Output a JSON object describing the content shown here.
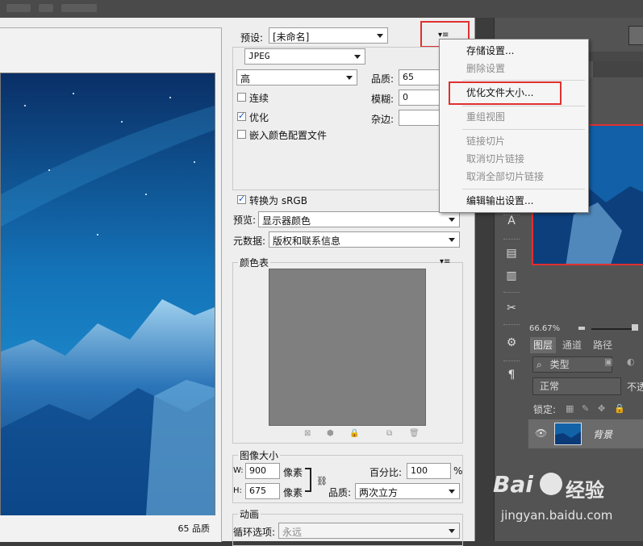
{
  "settings": {
    "preset_label": "预设:",
    "preset_value": "[未命名]",
    "format_value": "JPEG",
    "quality_level": "高",
    "quality_label": "品质:",
    "quality_value": "65",
    "progressive_label": "连续",
    "blur_label": "模糊:",
    "blur_value": "0",
    "optimized_label": "优化",
    "matte_label": "杂边:",
    "embed_profile_label": "嵌入颜色配置文件",
    "convert_srgb_label": "转换为 sRGB",
    "preview_label": "预览:",
    "preview_value": "显示器颜色",
    "metadata_label": "元数据:",
    "metadata_value": "版权和联系信息"
  },
  "color_table": {
    "title": "颜色表"
  },
  "image_size": {
    "title": "图像大小",
    "w_label": "W:",
    "w_value": "900",
    "h_label": "H:",
    "h_value": "675",
    "unit": "像素",
    "percent_label": "百分比:",
    "percent_value": "100",
    "percent_unit": "%",
    "quality_label": "品质:",
    "quality_value": "两次立方"
  },
  "animation": {
    "title": "动画",
    "loop_label": "循环选项:",
    "loop_value": "永远"
  },
  "preview_status": "65 品质",
  "menu": {
    "items": [
      {
        "label": "存储设置...",
        "enabled": true
      },
      {
        "label": "删除设置",
        "enabled": false
      },
      {
        "label": "优化文件大小...",
        "enabled": true
      },
      {
        "label": "重组视图",
        "enabled": false
      },
      {
        "label": "链接切片",
        "enabled": false
      },
      {
        "label": "取消切片链接",
        "enabled": false
      },
      {
        "label": "取消全部切片链接",
        "enabled": false
      },
      {
        "label": "编辑输出设置...",
        "enabled": true
      }
    ]
  },
  "navigator": {
    "zoom": "66.67%"
  },
  "layers": {
    "tabs": [
      "图层",
      "通道",
      "路径"
    ],
    "filter_label": "类型",
    "blend_mode": "正常",
    "opacity_partial": "不透",
    "lock_label": "锁定:",
    "layer_name": "背景"
  },
  "watermark": {
    "brand_text": "Bai",
    "brand_text2": "经验",
    "url": "jingyan.baidu.com"
  },
  "colors": {
    "highlight": "#e03030",
    "sky_top": "#0b3a78",
    "sky_bottom": "#1e8fd0"
  }
}
